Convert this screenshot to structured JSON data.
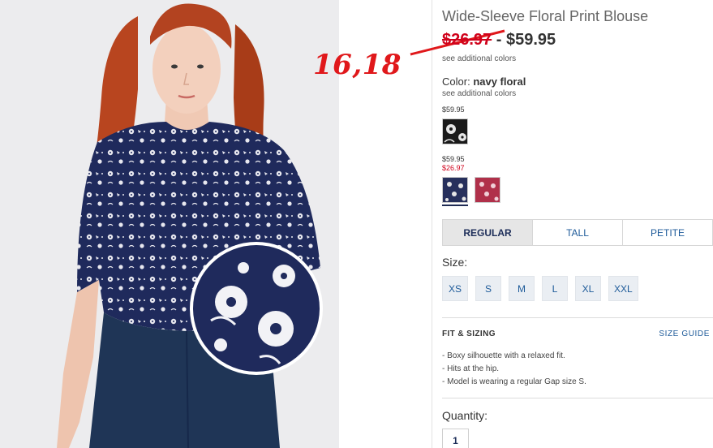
{
  "product": {
    "title": "Wide-Sleeve Floral Print Blouse",
    "price_old": "$26.97",
    "price_sep": "-",
    "price_new": "$59.95",
    "see_colors_top": "see additional colors"
  },
  "annotation": {
    "text": "16,18",
    "color": "#e0181b"
  },
  "color": {
    "label": "Color:",
    "value": "navy floral",
    "see_colors": "see additional colors",
    "swatches": [
      {
        "price": "$59.95",
        "sale_price": "",
        "fill": "#1a1a1a",
        "name": "black floral"
      },
      {
        "price": "$59.95",
        "sale_price": "$26.97",
        "fill": "#27305c",
        "name": "navy floral",
        "selected": true
      },
      {
        "price": "",
        "sale_price": "",
        "fill": "#b0304a",
        "name": "red floral"
      }
    ]
  },
  "fit": {
    "tabs": [
      "REGULAR",
      "TALL",
      "PETITE"
    ],
    "active": "REGULAR"
  },
  "size": {
    "label": "Size:",
    "options": [
      "XS",
      "S",
      "M",
      "L",
      "XL",
      "XXL"
    ]
  },
  "fit_sizing": {
    "heading": "FIT & SIZING",
    "guide_link": "SIZE GUIDE",
    "bullets": [
      "- Boxy silhouette with a relaxed fit.",
      "- Hits at the hip.",
      "- Model is wearing a regular Gap size S."
    ]
  },
  "quantity": {
    "label": "Quantity:",
    "value": "1"
  },
  "colors": {
    "sale_red": "#d0021b",
    "link_blue": "#1d5a99",
    "navy": "#1d2e59"
  }
}
